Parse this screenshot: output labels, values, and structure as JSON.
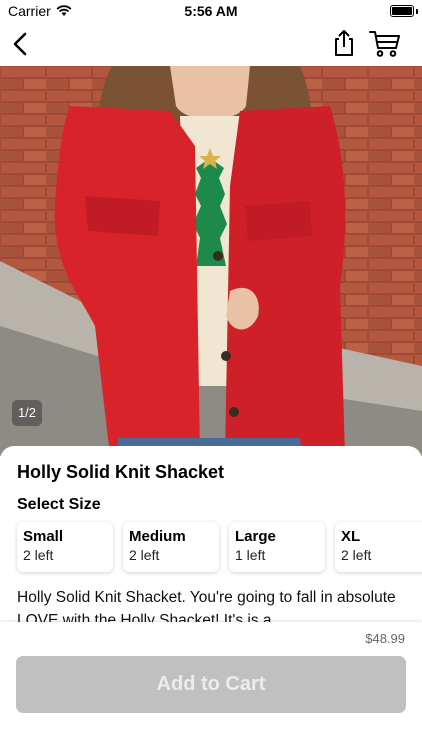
{
  "status_bar": {
    "carrier": "Carrier",
    "time": "5:56 AM"
  },
  "nav": {
    "icons": [
      "back-chevron-icon",
      "share-icon",
      "cart-icon"
    ]
  },
  "gallery": {
    "page_indicator": "1/2",
    "current_page": 1,
    "total_pages": 2
  },
  "product": {
    "title": "Holly Solid Knit Shacket",
    "select_size_label": "Select Size",
    "sizes": [
      {
        "name": "Small",
        "stock": "2 left"
      },
      {
        "name": "Medium",
        "stock": "2 left"
      },
      {
        "name": "Large",
        "stock": "1 left"
      },
      {
        "name": "XL",
        "stock": "2 left"
      }
    ],
    "description": "Holly Solid Knit Shacket. You're going to fall in absolute LOVE with the Holly Shacket! It's is a"
  },
  "purchase": {
    "price": "$48.99",
    "add_to_cart_label": "Add to Cart"
  },
  "colors": {
    "button_disabled": "#c0c0c0",
    "jacket_red": "#d8232b"
  }
}
